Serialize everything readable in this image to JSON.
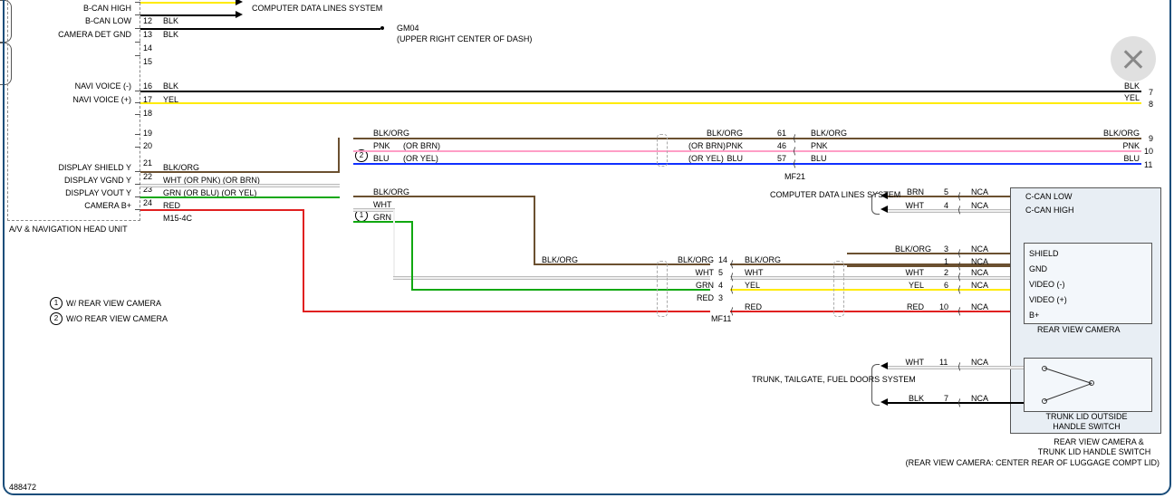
{
  "frame_border_color": "#1a4d7a",
  "close_button": {
    "icon": "close-x"
  },
  "head_unit": {
    "title": "A/V & NAVIGATION HEAD UNIT",
    "connector": "M15-4C",
    "pins": [
      {
        "num": "",
        "label": "B-CAN HIGH",
        "color": ""
      },
      {
        "num": "12",
        "label": "B-CAN LOW",
        "color": "BLK"
      },
      {
        "num": "13",
        "label": "CAMERA DET GND",
        "color": "BLK"
      },
      {
        "num": "14",
        "label": "",
        "color": ""
      },
      {
        "num": "15",
        "label": "",
        "color": ""
      },
      {
        "num": "16",
        "label": "NAVI VOICE (-)",
        "color": "BLK"
      },
      {
        "num": "17",
        "label": "NAVI VOICE (+)",
        "color": "YEL"
      },
      {
        "num": "18",
        "label": "",
        "color": ""
      },
      {
        "num": "19",
        "label": "",
        "color": ""
      },
      {
        "num": "20",
        "label": "",
        "color": ""
      },
      {
        "num": "21",
        "label": "DISPLAY SHIELD Y",
        "color": "BLK/ORG"
      },
      {
        "num": "22",
        "label": "DISPLAY VGND Y",
        "color": "WHT (OR PNK)   (OR BRN)"
      },
      {
        "num": "23",
        "label": "DISPLAY VOUT Y",
        "color": "GRN (OR BLU)   (OR YEL)"
      },
      {
        "num": "24",
        "label": "CAMERA B+",
        "color": "RED"
      }
    ]
  },
  "destinations": {
    "computer_data": "COMPUTER DATA LINES SYSTEM",
    "gm04": "GM04",
    "gm04_loc": "(UPPER RIGHT CENTER OF DASH)",
    "computer_data_2": "COMPUTER DATA LINES SYSTEM",
    "trunk_fuel": "TRUNK, TAILGATE, FUEL DOORS SYSTEM"
  },
  "legend": {
    "1": "W/ REAR VIEW CAMERA",
    "2": "W/O REAR VIEW CAMERA"
  },
  "mid_wires_2": [
    {
      "color": "BLK/ORG",
      "alt": ""
    },
    {
      "color": "PNK",
      "alt": "(OR BRN)"
    },
    {
      "color": "BLU",
      "alt": "(OR YEL)"
    }
  ],
  "mid_wires_1": [
    {
      "color": "BLK/ORG"
    },
    {
      "color": "WHT"
    },
    {
      "color": "GRN"
    }
  ],
  "splice_right": [
    {
      "color": "BLK/ORG",
      "pin": "61",
      "out": "BLK/ORG",
      "far": "BLK/ORG",
      "farnum": "9"
    },
    {
      "color": "PNK",
      "alt": "(OR BRN)",
      "pin": "46",
      "out": "PNK",
      "far": "PNK",
      "farnum": "10"
    },
    {
      "color": "BLU",
      "alt": "(OR YEL)",
      "pin": "57",
      "out": "BLU",
      "far": "BLU",
      "farnum": "11"
    }
  ],
  "mf21": "MF21",
  "mf11": "MF11",
  "right_edge": [
    {
      "color": "BLK",
      "num": "7"
    },
    {
      "color": "YEL",
      "num": "8"
    }
  ],
  "camera_block": {
    "title": "REAR VIEW CAMERA",
    "pins": [
      {
        "label": "C-CAN LOW"
      },
      {
        "label": "C-CAN HIGH"
      },
      {
        "label": "SHIELD"
      },
      {
        "label": "GND"
      },
      {
        "label": "VIDEO (-)"
      },
      {
        "label": "VIDEO (+)"
      },
      {
        "label": "B+"
      }
    ],
    "wires_top": [
      {
        "color": "BRN",
        "pin": "5",
        "nca": "NCA"
      },
      {
        "color": "WHT",
        "pin": "4",
        "nca": "NCA"
      }
    ],
    "wires_bottom": [
      {
        "color": "BLK/ORG",
        "pin": "3",
        "nca": "NCA",
        "mid": "BLK/ORG",
        "midpin": "14",
        "left": "BLK/ORG",
        "inner": "BLK/ORG",
        "innerpin": "1"
      },
      {
        "color": "WHT",
        "pin": "2",
        "nca": "NCA",
        "mid": "WHT",
        "midpin": "5",
        "left": "",
        "inner": "WHT"
      },
      {
        "color": "YEL",
        "pin": "6",
        "nca": "NCA",
        "mid": "GRN",
        "midpin": "4",
        "left": "",
        "inner": "YEL"
      },
      {
        "color": "RED",
        "pin": "10",
        "nca": "NCA",
        "mid": "RED",
        "midpin": "3",
        "left": "",
        "inner": "RED"
      }
    ]
  },
  "trunk_switch": {
    "title1": "TRUNK LID OUTSIDE",
    "title2": "HANDLE SWITCH",
    "wires": [
      {
        "color": "WHT",
        "pin": "11",
        "nca": "NCA"
      },
      {
        "color": "BLK",
        "pin": "7",
        "nca": "NCA"
      }
    ]
  },
  "assembly": {
    "title1": "REAR VIEW CAMERA &",
    "title2": "TRUNK LID HANDLE SWITCH",
    "loc": "(REAR VIEW CAMERA: CENTER REAR OF LUGGAGE COMPT LID)"
  },
  "doc_id": "488472"
}
